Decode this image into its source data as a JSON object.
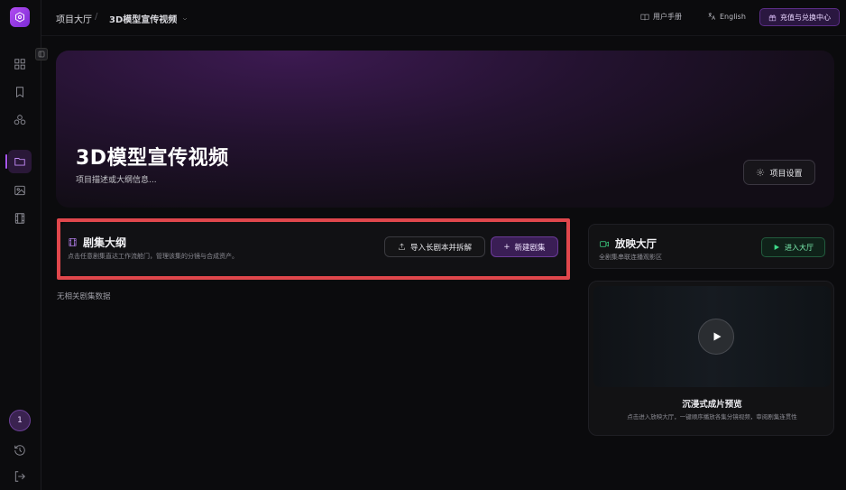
{
  "topbar": {
    "breadcrumb_root": "项目大厅",
    "breadcrumb_sep": "/",
    "breadcrumb_current": "3D模型宣传视频",
    "manual_label": "用户手册",
    "language_label": "English",
    "recharge_label": "充值与兑换中心"
  },
  "sidebar": {
    "avatar_label": "1",
    "items": [
      "dashboard-icon",
      "bookmark-icon",
      "assets-icon",
      "folder-icon",
      "image-icon",
      "film-icon"
    ],
    "accent_color": "#a855f7"
  },
  "hero": {
    "title": "3D模型宣传视频",
    "description": "项目描述或大纲信息...",
    "settings_label": "项目设置"
  },
  "outline": {
    "title": "剧集大纲",
    "subtitle": "点击任意剧集直达工作流舱门，管理该集的分镜与合成资产。",
    "import_label": "导入长剧本并拆解",
    "new_label": "新建剧集",
    "empty_text": "无相关剧集数据"
  },
  "screening": {
    "title": "放映大厅",
    "subtitle": "全剧集串联连播观影区",
    "enter_label": "进入大厅",
    "preview_title": "沉浸式成片预览",
    "preview_desc": "点击进入放映大厅，一键顺序播放各集分镜视频，审阅剧集连贯性"
  }
}
